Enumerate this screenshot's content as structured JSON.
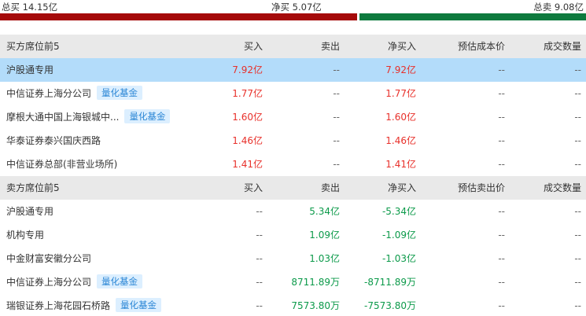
{
  "summary": {
    "total_buy": "总买 14.15亿",
    "net_buy": "净买 5.07亿",
    "total_sell": "总卖 9.08亿",
    "buy_share": 0.609
  },
  "buy_table": {
    "headers": [
      "买方席位前5",
      "买入",
      "卖出",
      "净买入",
      "预估成本价",
      "成交数量"
    ],
    "rows": [
      {
        "name": "沪股通专用",
        "badge": "",
        "buy": "7.92亿",
        "sell": "--",
        "net": "7.92亿",
        "cost": "--",
        "vol": "--"
      },
      {
        "name": "中信证券上海分公司",
        "badge": "量化基金",
        "buy": "1.77亿",
        "sell": "--",
        "net": "1.77亿",
        "cost": "--",
        "vol": "--"
      },
      {
        "name": "摩根大通中国上海银城中...",
        "badge": "量化基金",
        "buy": "1.60亿",
        "sell": "--",
        "net": "1.60亿",
        "cost": "--",
        "vol": "--"
      },
      {
        "name": "华泰证券泰兴国庆西路",
        "badge": "",
        "buy": "1.46亿",
        "sell": "--",
        "net": "1.46亿",
        "cost": "--",
        "vol": "--"
      },
      {
        "name": "中信证券总部(非营业场所)",
        "badge": "",
        "buy": "1.41亿",
        "sell": "--",
        "net": "1.41亿",
        "cost": "--",
        "vol": "--"
      }
    ]
  },
  "sell_table": {
    "headers": [
      "卖方席位前5",
      "买入",
      "卖出",
      "净买入",
      "预估卖出价",
      "成交数量"
    ],
    "rows": [
      {
        "name": "沪股通专用",
        "badge": "",
        "buy": "--",
        "sell": "5.34亿",
        "net": "-5.34亿",
        "cost": "--",
        "vol": "--"
      },
      {
        "name": "机构专用",
        "badge": "",
        "buy": "--",
        "sell": "1.09亿",
        "net": "-1.09亿",
        "cost": "--",
        "vol": "--"
      },
      {
        "name": "中金财富安徽分公司",
        "badge": "",
        "buy": "--",
        "sell": "1.03亿",
        "net": "-1.03亿",
        "cost": "--",
        "vol": "--"
      },
      {
        "name": "中信证券上海分公司",
        "badge": "量化基金",
        "buy": "--",
        "sell": "8711.89万",
        "net": "-8711.89万",
        "cost": "--",
        "vol": "--"
      },
      {
        "name": "瑞银证券上海花园石桥路",
        "badge": "量化基金",
        "buy": "--",
        "sell": "7573.80万",
        "net": "-7573.80万",
        "cost": "--",
        "vol": "--"
      }
    ]
  },
  "colors": {
    "buy_bar": "#a50a0a",
    "sell_bar": "#0e7a3e",
    "positive": "#e8302a",
    "negative": "#0c9a4a",
    "highlight": "#b3dcfa",
    "badge_text": "#2a86d5",
    "badge_bg": "#dcefff"
  }
}
